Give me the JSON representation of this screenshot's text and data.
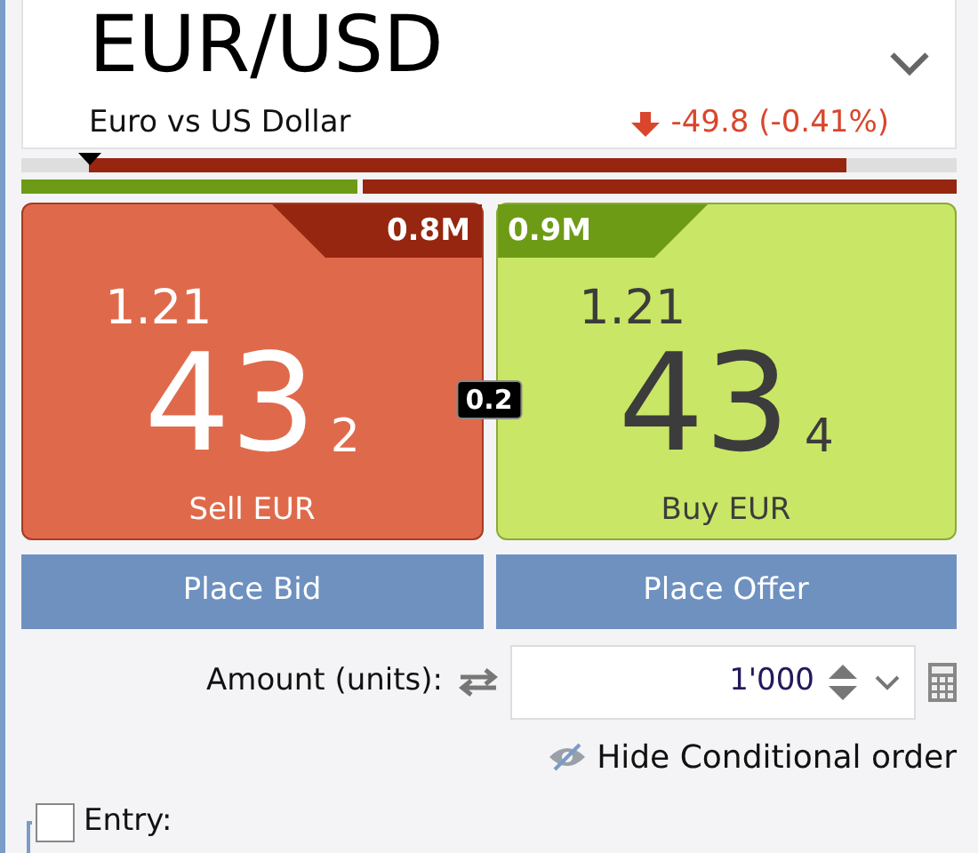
{
  "header": {
    "symbol": "EUR/USD",
    "description": "Euro vs US Dollar",
    "change": "-49.8 (-0.41%)"
  },
  "sentiment": {
    "level": 0.365
  },
  "quotes": [
    {
      "kind": "sell",
      "volume": "0.8M",
      "big_figure": "1.21",
      "pips": "43",
      "fraction": "2",
      "action": "Sell EUR"
    },
    {
      "kind": "buy",
      "volume": "0.9M",
      "big_figure": "1.21",
      "pips": "43",
      "fraction": "4",
      "action": "Buy EUR"
    }
  ],
  "spread": "0.2",
  "buttons": [
    "Place Bid",
    "Place Offer"
  ],
  "amount": {
    "label": "Amount (units):",
    "value": "1'000"
  },
  "conditional_link": "Hide Conditional order",
  "entry": {
    "label": "Entry:",
    "checked": false
  }
}
